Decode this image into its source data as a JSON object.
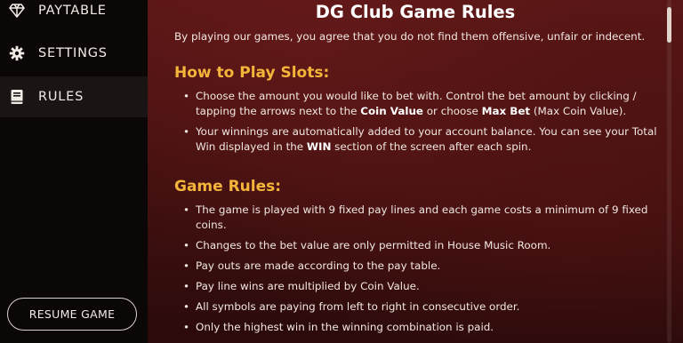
{
  "menu": {
    "items": [
      {
        "label": "PAYTABLE",
        "icon": "diamond-icon"
      },
      {
        "label": "SETTINGS",
        "icon": "gear-icon"
      },
      {
        "label": "RULES",
        "icon": "book-icon",
        "active": true
      }
    ],
    "resume_label": "RESUME GAME"
  },
  "content": {
    "title": "DG Club Game Rules",
    "intro": "By playing our games, you agree that you do not find them offensive, unfair or indecent.",
    "how_to_play": {
      "heading": "How to Play Slots:",
      "items": [
        {
          "pre": "Choose the amount you would like to bet with. Control the bet amount by clicking / tapping the arrows next to the ",
          "b1": "Coin Value",
          "mid": " or choose ",
          "b2": "Max Bet",
          "post": " (Max Coin Value)."
        },
        {
          "pre": "Your winnings are automatically added to your account balance. You can see your Total Win displayed in the ",
          "b1": "WIN",
          "post": " section of the screen after each spin."
        }
      ]
    },
    "game_rules": {
      "heading": "Game Rules:",
      "items": [
        "The game is played with 9 fixed pay lines and each game costs a minimum of 9 fixed coins.",
        "Changes to the bet value are only permitted in House Music Room.",
        "Pay outs are made according to the pay table.",
        "Pay line wins are multiplied by Coin Value.",
        "All symbols are paying from left to right in consecutive order.",
        "Only the highest win in the winning combination is paid."
      ]
    }
  },
  "colors": {
    "heading": "#f3b53a",
    "sidebar": "#0b0707",
    "background": "#4a1212"
  }
}
